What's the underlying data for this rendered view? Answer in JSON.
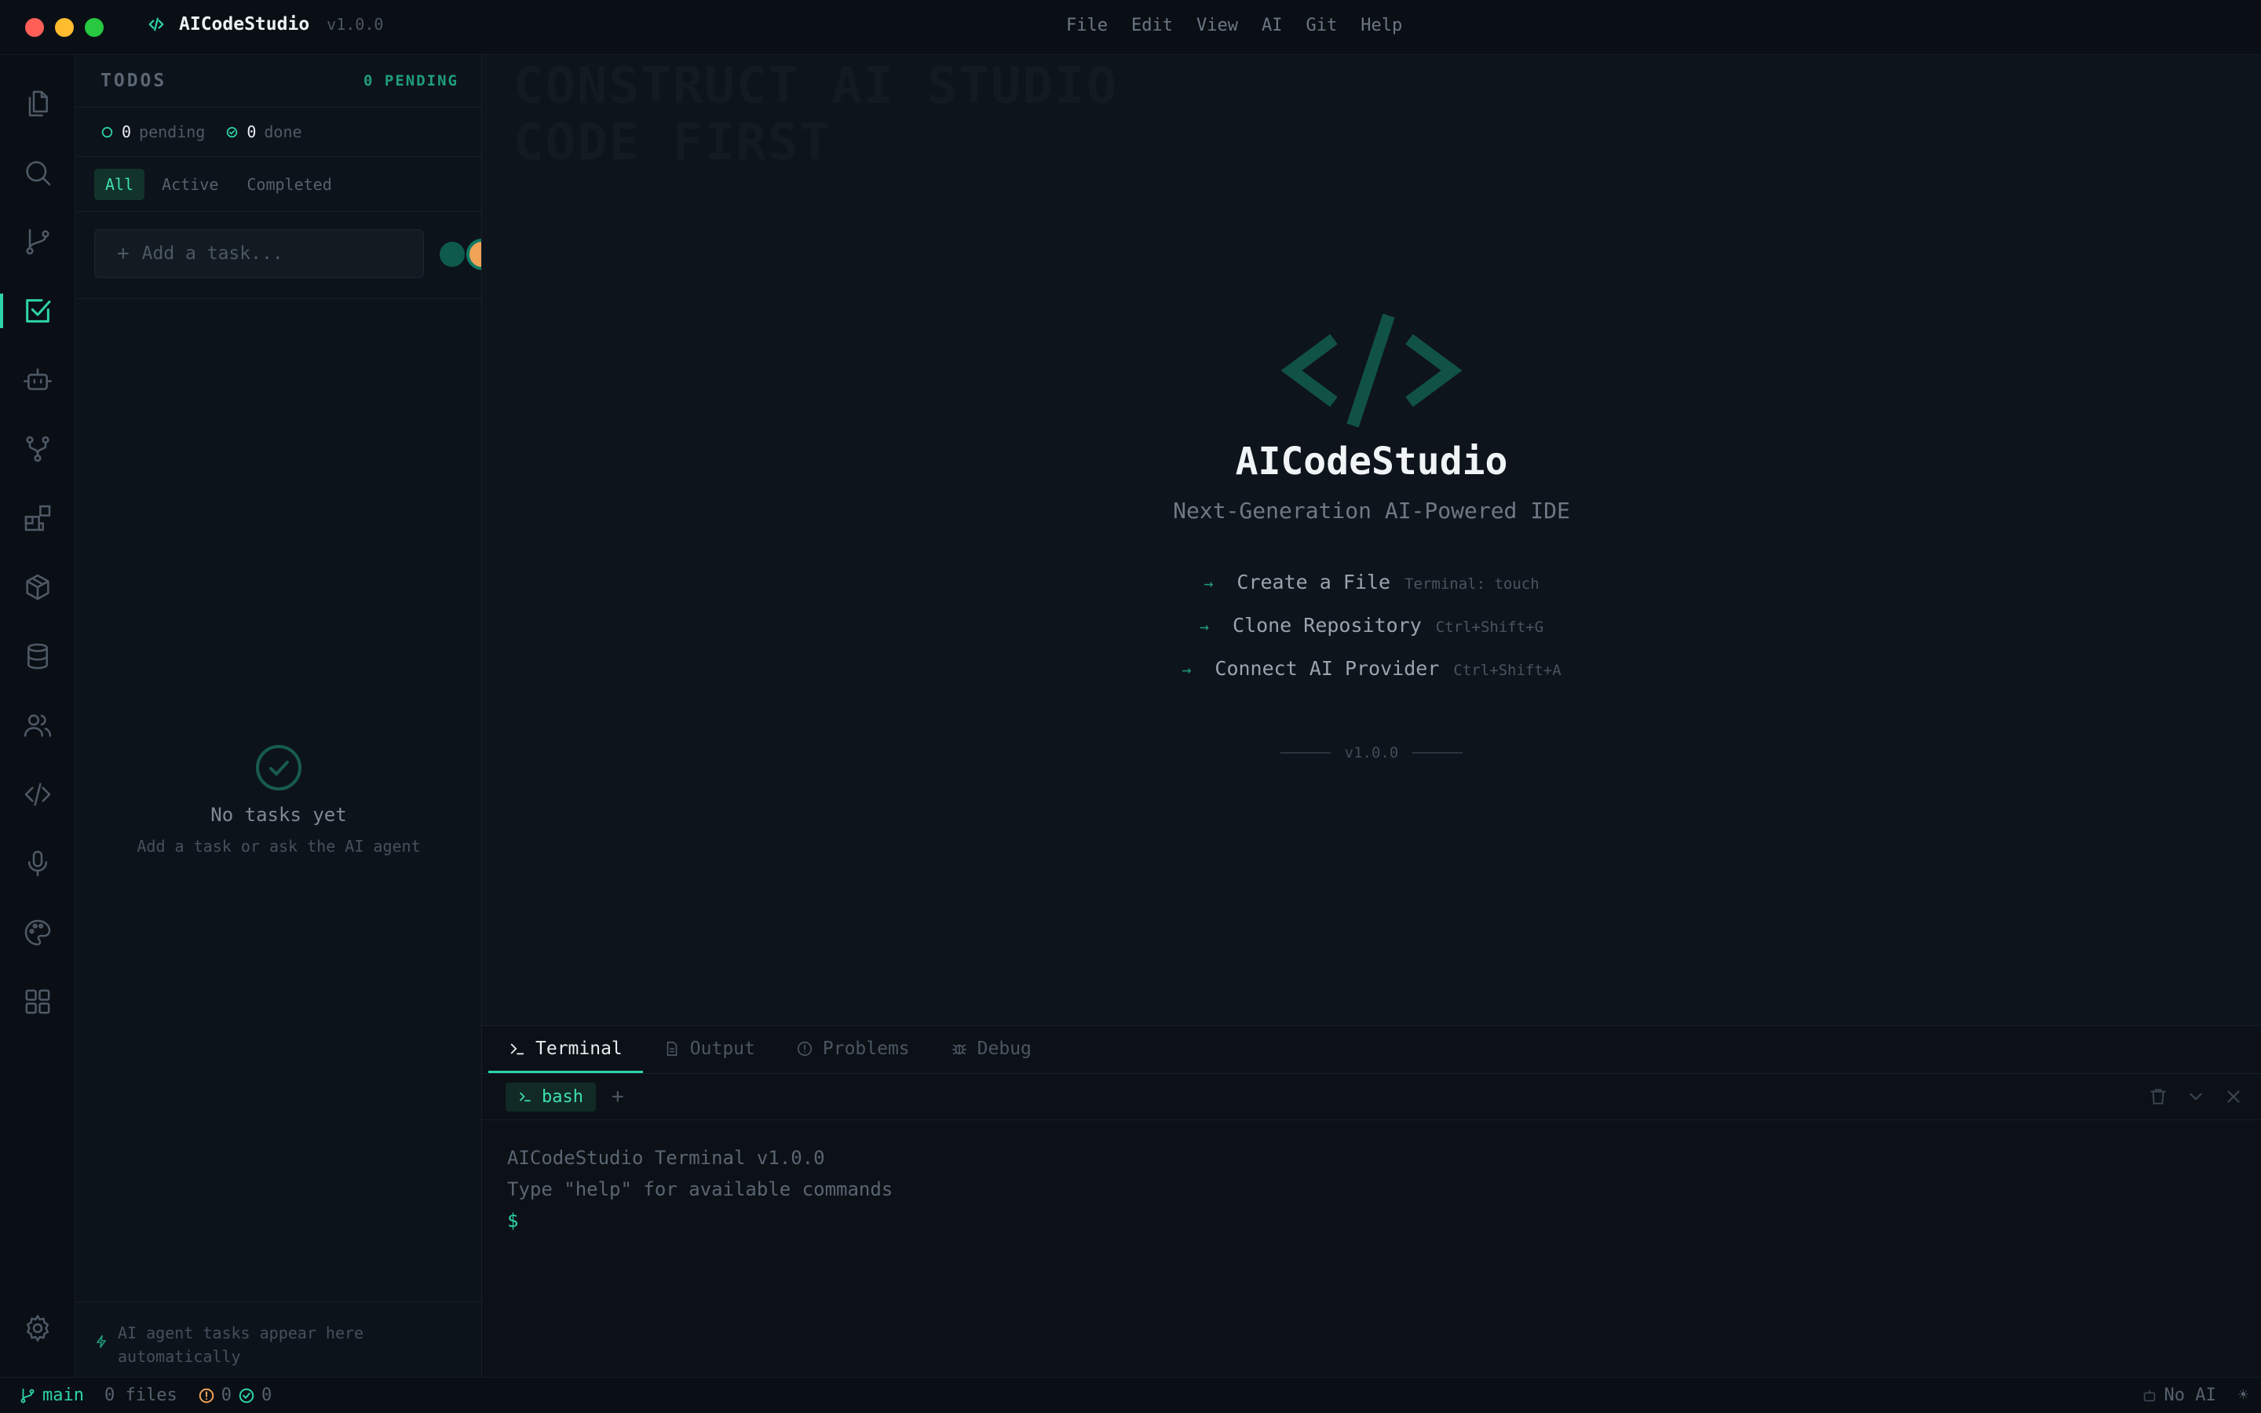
{
  "window": {
    "app_name": "AICodeStudio",
    "version": "v1.0.0",
    "menus": [
      "File",
      "Edit",
      "View",
      "AI",
      "Git",
      "Help"
    ]
  },
  "activity_bar": {
    "items": [
      "explorer-icon",
      "search-icon",
      "source-control-icon",
      "todos-icon",
      "ai-agent-icon",
      "git-graph-icon",
      "extensions-icon",
      "packages-icon",
      "database-icon",
      "collaboration-icon",
      "code-icon",
      "microphone-icon",
      "palette-icon",
      "apps-grid-icon"
    ],
    "active": "todos-icon",
    "bottom": "settings-icon"
  },
  "todos": {
    "title": "TODOS",
    "pending_badge": "0 PENDING",
    "pending_count": "0",
    "pending_label": "pending",
    "done_count": "0",
    "done_label": "done",
    "filters": [
      "All",
      "Active",
      "Completed"
    ],
    "active_filter": "All",
    "add_placeholder": "Add a task...",
    "empty_title": "No tasks yet",
    "empty_subtitle": "Add a task or ask the AI agent",
    "footer_note": "AI agent tasks appear here automatically"
  },
  "welcome": {
    "ghost_text": [
      "CONSTRUCT AI STUDIO",
      "CODE FIRST"
    ],
    "title": "AICodeStudio",
    "subtitle": "Next-Generation AI-Powered IDE",
    "actions": [
      {
        "label": "Create a File",
        "shortcut": "Terminal: touch"
      },
      {
        "label": "Clone Repository",
        "shortcut": "Ctrl+Shift+G"
      },
      {
        "label": "Connect AI Provider",
        "shortcut": "Ctrl+Shift+A"
      }
    ],
    "version": "v1.0.0"
  },
  "panel": {
    "tabs": [
      "Terminal",
      "Output",
      "Problems",
      "Debug"
    ],
    "active_tab": "Terminal",
    "terminal_tab": "bash",
    "new_terminal": "+",
    "lines": [
      "AICodeStudio Terminal v1.0.0",
      "Type \"help\" for available commands"
    ],
    "prompt": "$"
  },
  "statusbar": {
    "branch": "main",
    "files": "0 files",
    "errors": "0",
    "checks": "0",
    "ai_status": "No AI",
    "theme_toggle": "☀"
  },
  "colors": {
    "accent": "#2dd4a8",
    "background": "#0c1118",
    "sidebar": "#0d131a",
    "warning": "#f0a256"
  }
}
